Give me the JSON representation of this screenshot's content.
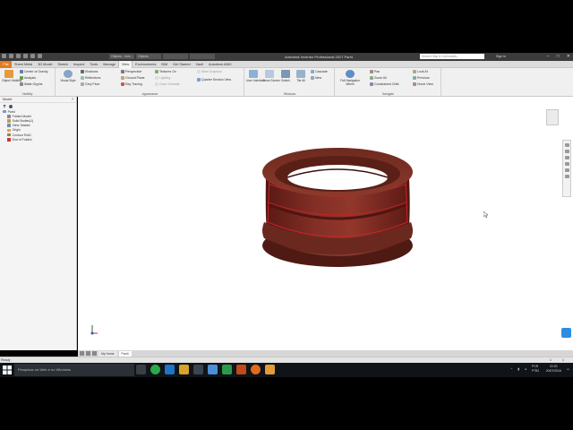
{
  "title_bar": {
    "doc_tabs": [
      "Objects - Inve...",
      "Objects",
      "",
      ""
    ],
    "app_title": "Autodesk Inventor Professional 2017   Part4",
    "search_placeholder": "Search Help & Commands...",
    "sign_in": "Sign In",
    "window_controls": [
      "–",
      "□",
      "✕"
    ]
  },
  "menu": {
    "file": "File",
    "tabs": [
      "Sheet Metal",
      "3D Model",
      "Sketch",
      "Inspect",
      "Tools",
      "Manage",
      "View",
      "Environments",
      "BIM",
      "Get Started",
      "Vault",
      "Autodesk A360"
    ],
    "active_tab": "View"
  },
  "ribbon": {
    "visibility": {
      "object_visibility": "Object Visibility",
      "items": [
        "Center of Gravity",
        "Analysis",
        "iMate Glyphs"
      ],
      "title": "Visibility"
    },
    "appearance": {
      "visual_style": "Visual Style",
      "col1": [
        "Shadows",
        "Reflections",
        "Grey Floor"
      ],
      "col2": [
        "Perspective",
        "Ground Plane",
        "Ray Tracing"
      ],
      "col3": [
        "Textures On",
        "Lighting",
        "Color Override"
      ],
      "col4": [
        "Slice Graphics",
        "Quarter Section View"
      ],
      "title": "Appearance"
    },
    "windows": {
      "buttons": [
        "User Interface",
        "Clean Screen",
        "Switch",
        "Tile All"
      ],
      "small": [
        "Cascade",
        "New"
      ],
      "title": "Windows"
    },
    "navigate": {
      "full_nav": "Full Navigation Wheel",
      "col1": [
        "Pan",
        "Zoom All",
        "Constrained Orbit"
      ],
      "col2": [
        "Look At",
        "Previous",
        "Home View"
      ],
      "title": "Navigate"
    }
  },
  "browser": {
    "header": "Model",
    "nodes": [
      {
        "label": "Part4",
        "color": "#7a9cc6",
        "indent": 0
      },
      {
        "label": "Folded Model",
        "color": "#888888",
        "indent": 1
      },
      {
        "label": "Solid Bodies(1)",
        "color": "#c29a4b",
        "indent": 1
      },
      {
        "label": "View: Master",
        "color": "#6a8fb5",
        "indent": 1
      },
      {
        "label": "Origin",
        "color": "#d7a93b",
        "indent": 1
      },
      {
        "label": "Contour Roll1",
        "color": "#9c7b55",
        "indent": 1
      },
      {
        "label": "End of Folded",
        "color": "#cc3333",
        "indent": 1
      }
    ]
  },
  "doc_tabs": {
    "home": "My Home",
    "part": "Part4"
  },
  "status": {
    "text": "Ready",
    "nums": [
      "1",
      "1"
    ]
  },
  "taskbar": {
    "search_placeholder": "Pesquisar na Web e no Windows",
    "lang": "POR PTB2",
    "time": "22:20",
    "date": "20/07/2016"
  },
  "colors": {
    "accent": "#e27b24",
    "model_body": "#6f2a20",
    "model_highlight": "#d0202a"
  }
}
